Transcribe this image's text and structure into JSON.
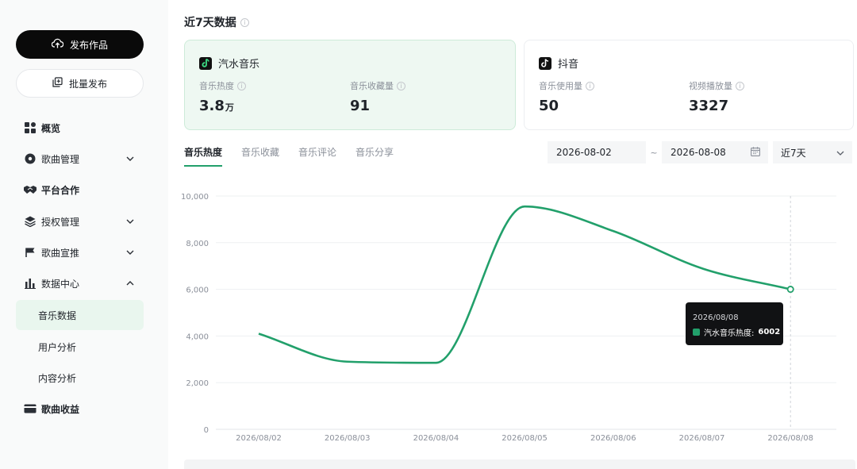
{
  "sidebar": {
    "publish_label": "发布作品",
    "batch_label": "批量发布",
    "items": [
      {
        "label": "概览",
        "icon": "grid-icon"
      },
      {
        "label": "歌曲管理",
        "icon": "disc-icon"
      },
      {
        "label": "平台合作",
        "icon": "handshake-icon"
      },
      {
        "label": "授权管理",
        "icon": "layers-icon"
      },
      {
        "label": "歌曲宣推",
        "icon": "flag-icon"
      },
      {
        "label": "数据中心",
        "icon": "bar-chart-icon"
      },
      {
        "label": "歌曲收益",
        "icon": "wallet-icon"
      }
    ],
    "sub_items": [
      "音乐数据",
      "用户分析",
      "内容分析"
    ]
  },
  "section_title": "近7天数据",
  "cards": {
    "qishui": {
      "name": "汽水音乐",
      "metric1_label": "音乐热度",
      "metric1_value": "3.8",
      "metric1_unit": "万",
      "metric2_label": "音乐收藏量",
      "metric2_value": "91"
    },
    "douyin": {
      "name": "抖音",
      "metric1_label": "音乐使用量",
      "metric1_value": "50",
      "metric2_label": "视频播放量",
      "metric2_value": "3327"
    }
  },
  "tabs": [
    "音乐热度",
    "音乐收藏",
    "音乐评论",
    "音乐分享"
  ],
  "date_range": {
    "start": "2026-08-02",
    "separator": "~",
    "end": "2026-08-08"
  },
  "period": "近7天",
  "tooltip": {
    "date": "2026/08/08",
    "series_label": "汽水音乐热度:",
    "value": "6002"
  },
  "colors": {
    "accent": "#22a06b",
    "card_green_bg": "#eef8f2"
  },
  "chart_data": {
    "type": "line",
    "x": [
      "2026/08/02",
      "2026/08/03",
      "2026/08/04",
      "2026/08/05",
      "2026/08/06",
      "2026/08/07",
      "2026/08/08"
    ],
    "series": [
      {
        "name": "汽水音乐热度",
        "values": [
          4100,
          2900,
          2850,
          9550,
          8500,
          6900,
          6002
        ]
      }
    ],
    "ylim": [
      0,
      10000
    ],
    "yticks": [
      "0",
      "2,000",
      "4,000",
      "6,000",
      "8,000",
      "10,000"
    ],
    "ytick_values": [
      0,
      2000,
      4000,
      6000,
      8000,
      10000
    ],
    "grid": true,
    "legend": "none"
  }
}
